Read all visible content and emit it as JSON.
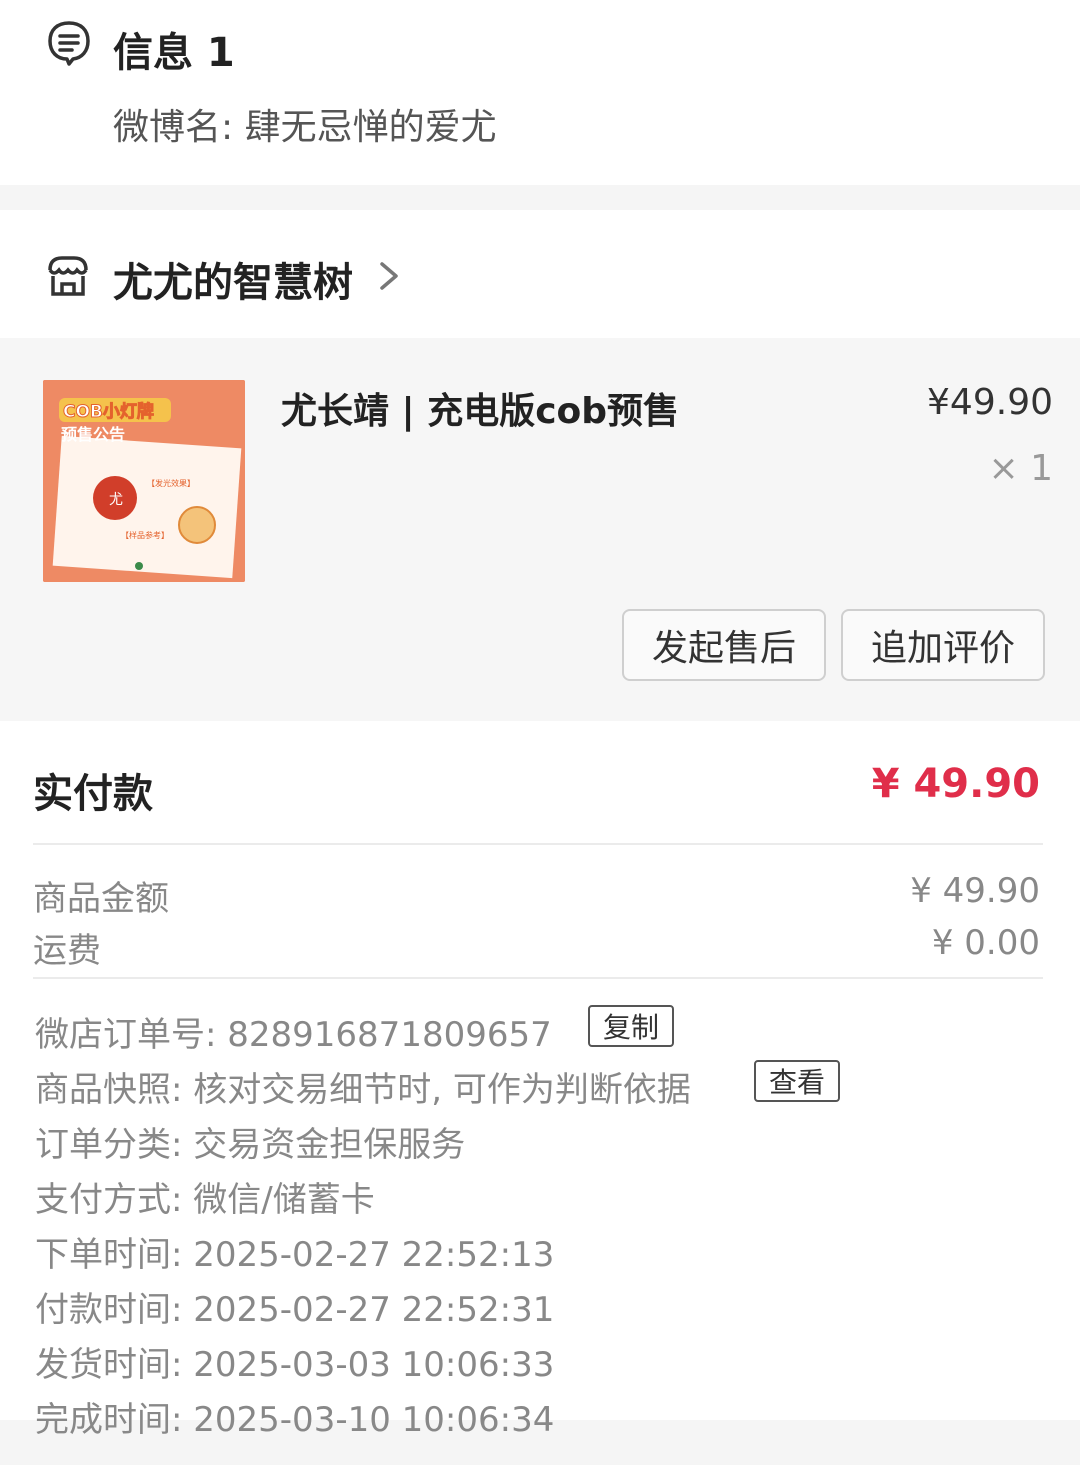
{
  "info": {
    "title": "信息 1",
    "subtitle": "微博名: 肆无忌惮的爱尤"
  },
  "shop": {
    "name": "尤尤的智慧树"
  },
  "item": {
    "title": "尤长靖 | 充电版cob预售",
    "price": "¥49.90",
    "quantity": "× 1",
    "thumb_text_1": "COB小灯牌",
    "thumb_text_2": "预售公告",
    "thumb_tag_1": "【发光效果】",
    "thumb_tag_2": "【样品参考】",
    "thumb_char": "尤",
    "buttons": {
      "after_sale": "发起售后",
      "add_review": "追加评价"
    }
  },
  "payment": {
    "paid_label": "实付款",
    "paid_amount": "¥ 49.90",
    "goods_label": "商品金额",
    "goods_amount": "¥ 49.90",
    "shipping_label": "运费",
    "shipping_amount": "¥ 0.00"
  },
  "details": {
    "order_no": "微店订单号:  828916871809657",
    "copy_label": "复制",
    "snapshot": "商品快照: 核对交易细节时, 可作为判断依据",
    "view_label": "查看",
    "category": "订单分类:  交易资金担保服务",
    "pay_method": "支付方式:  微信/储蓄卡",
    "order_time": "下单时间:  2025-02-27 22:52:13",
    "pay_time": "付款时间:  2025-02-27 22:52:31",
    "ship_time": "发货时间:  2025-03-03 10:06:33",
    "done_time": "完成时间:  2025-03-10 10:06:34"
  },
  "colors": {
    "accent_red": "#e02e4a",
    "thumb_orange": "#f08b63"
  },
  "icons": {
    "info": "message-lines-icon",
    "shop": "storefront-icon",
    "chevron": "chevron-right-icon"
  }
}
